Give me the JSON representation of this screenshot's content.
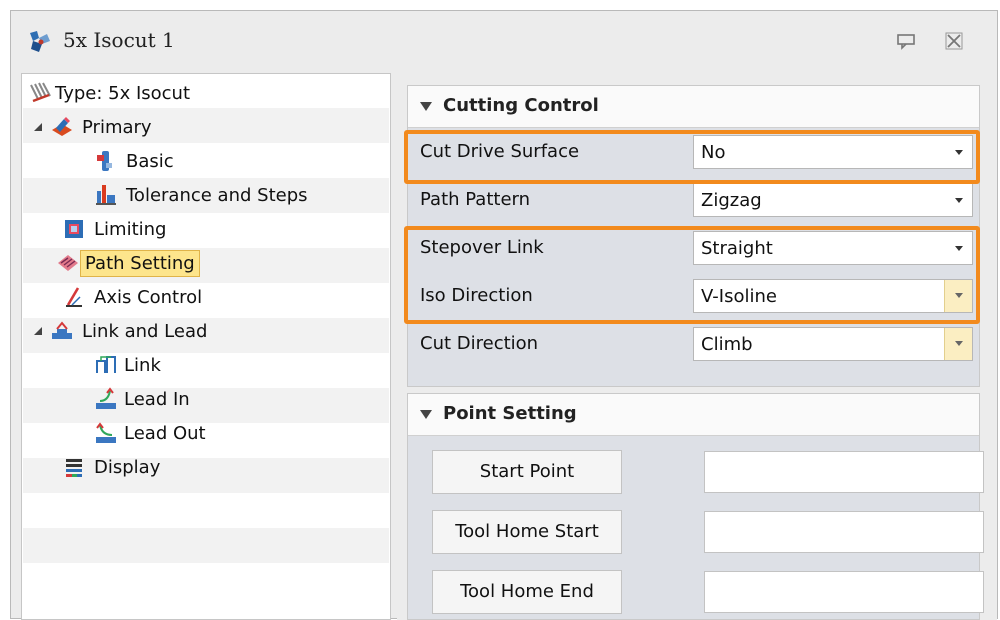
{
  "window": {
    "title": "5x Isocut 1",
    "icons": [
      "app-icon",
      "pin-icon",
      "close-icon"
    ]
  },
  "tree": {
    "type_label": "Type: 5x Isocut",
    "items": [
      {
        "label": "Primary",
        "icon": "primary-icon"
      },
      {
        "label": "Basic",
        "icon": "basic-icon"
      },
      {
        "label": "Tolerance and Steps",
        "icon": "tolerance-icon"
      },
      {
        "label": "Limiting",
        "icon": "limiting-icon"
      },
      {
        "label": "Path Setting",
        "icon": "path-setting-icon",
        "selected": true
      },
      {
        "label": "Axis Control",
        "icon": "axis-control-icon"
      },
      {
        "label": "Link and Lead",
        "icon": "link-lead-icon"
      },
      {
        "label": "Link",
        "icon": "link-icon"
      },
      {
        "label": "Lead In",
        "icon": "lead-in-icon"
      },
      {
        "label": "Lead Out",
        "icon": "lead-out-icon"
      },
      {
        "label": "Display",
        "icon": "display-icon"
      }
    ]
  },
  "cutting_control": {
    "title": "Cutting Control",
    "rows": [
      {
        "label": "Cut Drive Surface",
        "value": "No"
      },
      {
        "label": "Path Pattern",
        "value": "Zigzag"
      },
      {
        "label": "Stepover Link",
        "value": "Straight"
      },
      {
        "label": "Iso Direction",
        "value": "V-Isoline"
      },
      {
        "label": "Cut Direction",
        "value": "Climb"
      }
    ]
  },
  "point_setting": {
    "title": "Point Setting",
    "buttons": [
      {
        "label": "Start Point",
        "value": ""
      },
      {
        "label": "Tool Home Start",
        "value": ""
      },
      {
        "label": "Tool Home End",
        "value": ""
      }
    ]
  },
  "colors": {
    "highlight": "#f28a1d",
    "selected_bg": "#fde58c",
    "group_bg": "#dde0e6"
  }
}
